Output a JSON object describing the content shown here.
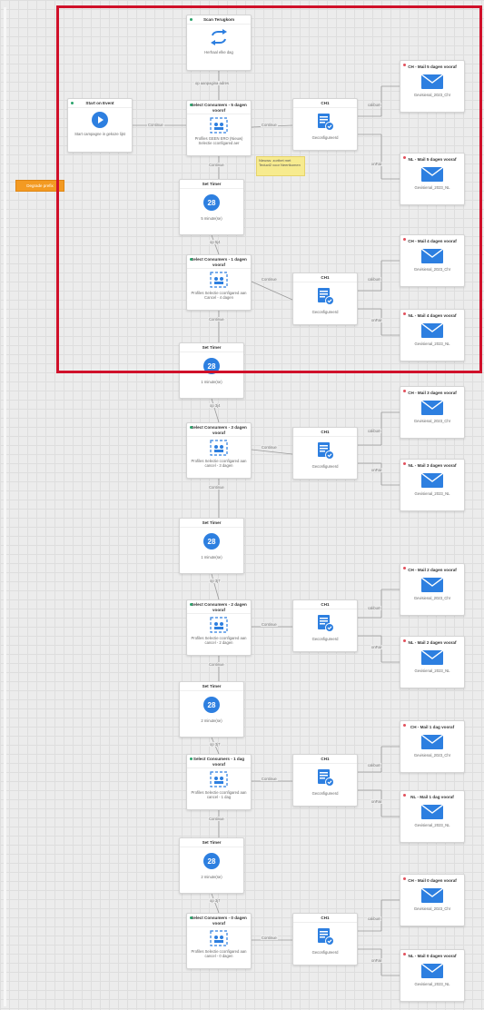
{
  "start": {
    "title": "Start on Event",
    "sub": "Start campagne in gekoze lijst"
  },
  "trigger_top": {
    "title": "Scan Terugkom",
    "sub": "Herhaal elke dag"
  },
  "top_conn": "op aanpagina adres",
  "orange_label": "Degrade prefix",
  "note": "Nieuws: zorthet met Teduct2 voor Neertkomen",
  "continue": "Continue",
  "rows": [
    {
      "select": {
        "title": "Select Consumers - 5 dagen voorof",
        "sub": "Profiles GEEN ERO (Nieuw) Selectie cconfigared aer"
      },
      "timer": {
        "title": "Set Timer",
        "value": "28",
        "sub": "5 minute(se)"
      },
      "timer_conn": "op 5j4",
      "ch": {
        "title": "CH1",
        "sub": "Geconfigureerd"
      },
      "mail_a": {
        "title": "CH - Mail 5 dagen vooraf",
        "sub": "Gevisienal_2023_Chr"
      },
      "mail_b": {
        "title": "NL - Mail 5 dagen vooraf",
        "sub": "Gevisienal_2023_NL"
      }
    },
    {
      "select": {
        "title": "Select Consumers - 1 dagen vooraf",
        "sub": "Profiles Selectie cconfigared aan Cancel - 4 dagen"
      },
      "timer": {
        "title": "Set Timer",
        "value": "28",
        "sub": "1 minute(se)"
      },
      "timer_conn": "op 3j4",
      "ch": {
        "title": "CH1",
        "sub": "Geconfigureerd"
      },
      "mail_a": {
        "title": "CH - Mail 4 dagen vooraf",
        "sub": "Gevisienal_2023_Chr"
      },
      "mail_b": {
        "title": "NL - Mail 4 dagen vooraf",
        "sub": "Gevisienal_2023_NL"
      }
    },
    {
      "select": {
        "title": "Select Consumers - 3 dagen vooraf",
        "sub": "Profiles Selectie cconfigared aan cancel - 3 dagen"
      },
      "timer": {
        "title": "Set Timer",
        "value": "28",
        "sub": "1 minute(se)"
      },
      "timer_conn": "op 3j7",
      "ch": {
        "title": "CH1",
        "sub": "Geconfigureerd"
      },
      "mail_a": {
        "title": "CH - Mail 3 dagen vooraf",
        "sub": "Gevisienal_2023_Chr"
      },
      "mail_b": {
        "title": "NL - Mail 3 dagen vooraf",
        "sub": "Gevisienal_2023_NL"
      }
    },
    {
      "select": {
        "title": "Select Consumers - 2 dagen vooraf",
        "sub": "Profiles Selectie cconfigared aan cancel - 2 dagen"
      },
      "timer": {
        "title": "Set Timer",
        "value": "28",
        "sub": "2 minute(se)"
      },
      "timer_conn": "op 3j7",
      "ch": {
        "title": "CH1",
        "sub": "Geconfigureerd"
      },
      "mail_a": {
        "title": "CH - Mail 2 dagen vooraf",
        "sub": "Gevisienal_2023_Chr"
      },
      "mail_b": {
        "title": "NL - Mail 2 dagen vooraf",
        "sub": "Gevisienal_2023_NL"
      }
    },
    {
      "select": {
        "title": "Select Consumers - 1 dag vooraf",
        "sub": "Profiles Selectie cconfigared aan cancel - 1 dag"
      },
      "timer": {
        "title": "Set Timer",
        "value": "28",
        "sub": "2 minute(se)"
      },
      "timer_conn": "op 3j7",
      "ch": {
        "title": "CH1",
        "sub": "Geconfigureerd"
      },
      "mail_a": {
        "title": "CH - Mail 1 dag vooraf",
        "sub": "Gevisienal_2023_Chr"
      },
      "mail_b": {
        "title": "NL - Mail 1 dag vooraf",
        "sub": "Gevisienal_2023_NL"
      }
    },
    {
      "select": {
        "title": "Select Consumers - 0 dagen vooraf",
        "sub": "Profiles Selectie cconfigared aan cancel - 0 dagen"
      },
      "ch": {
        "title": "CH1",
        "sub": "Geconfigureerd"
      },
      "mail_a": {
        "title": "CH - Mail 0 dagen vooraf",
        "sub": "Gevisienal_2023_Chr"
      },
      "mail_b": {
        "title": "NL - Mail 0 dagen vooraf",
        "sub": "Gevisienal_2023_NL"
      }
    }
  ],
  "branch_labels": {
    "a": "calibum",
    "b": "onFail"
  },
  "colors": {
    "accent": "#2d7fe0",
    "highlight": "#d0102a",
    "orange": "#f39a22",
    "note": "#f7eb8f"
  }
}
